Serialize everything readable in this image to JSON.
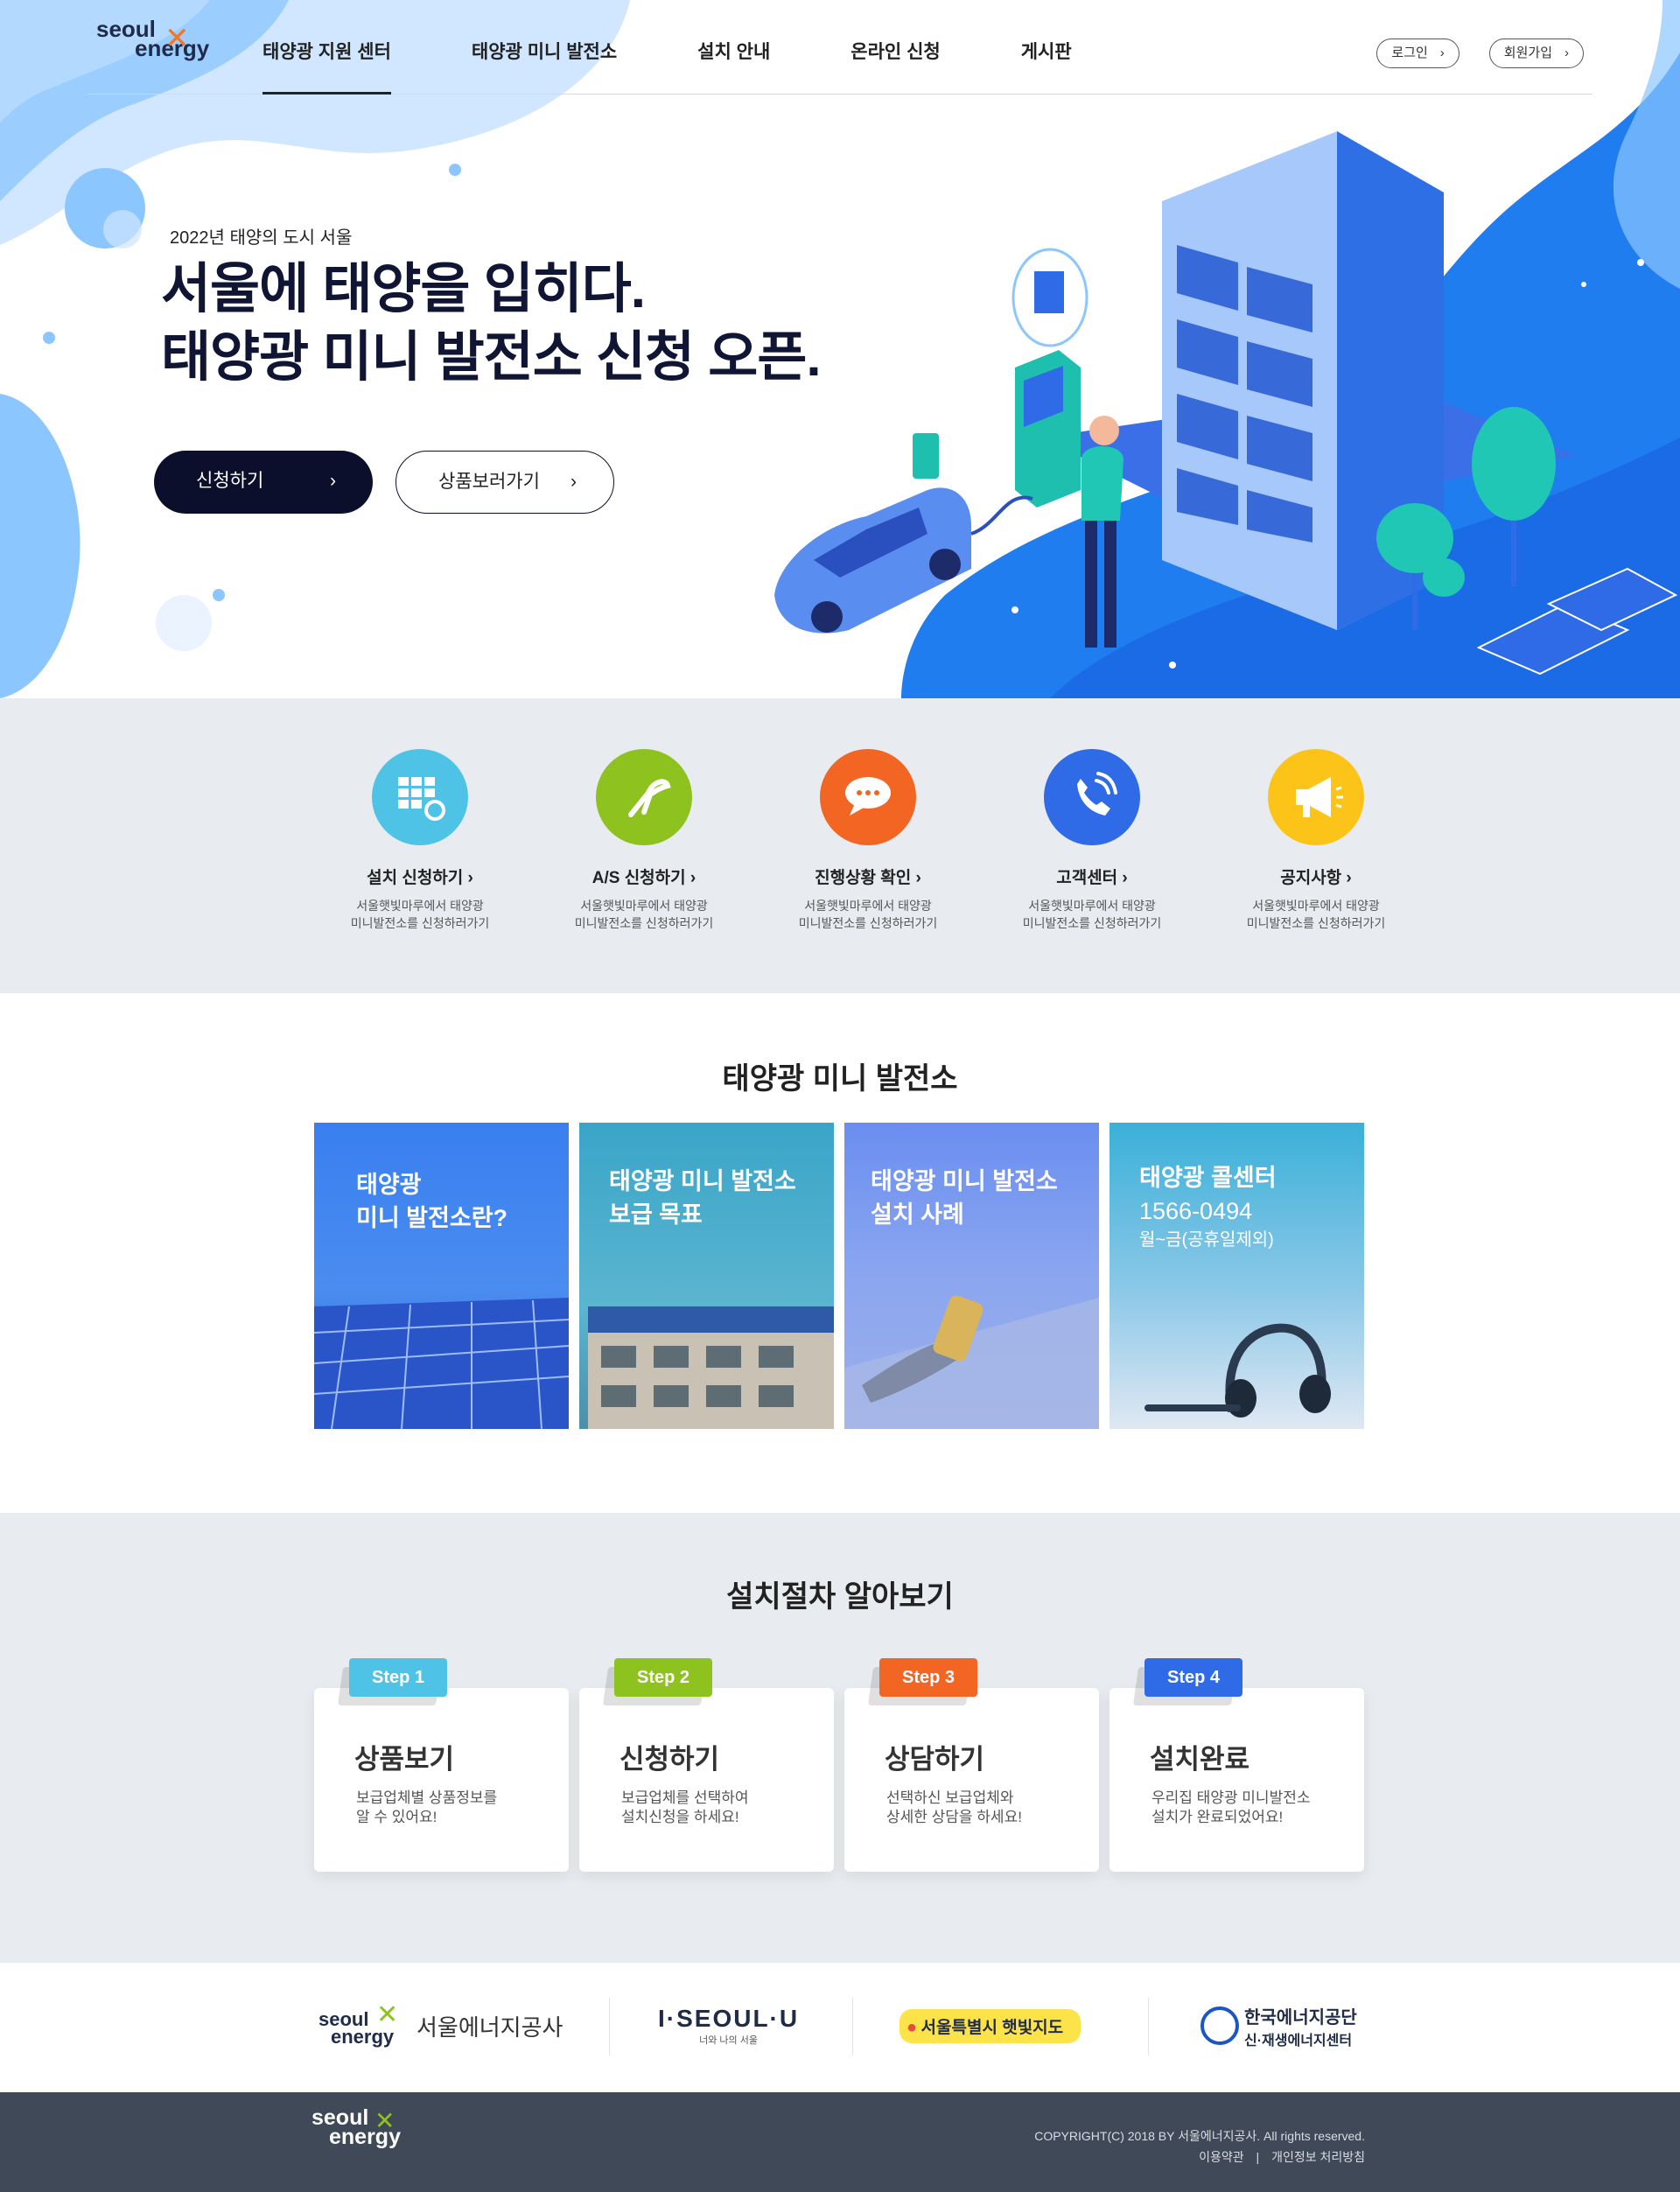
{
  "brand": {
    "logo_line1": "seoul",
    "logo_line2": "energy",
    "logo_mark": "✕"
  },
  "nav": {
    "items": [
      {
        "label": "태양광 지원 센터"
      },
      {
        "label": "태양광 미니 발전소"
      },
      {
        "label": "설치 안내"
      },
      {
        "label": "온라인 신청"
      },
      {
        "label": "게시판"
      }
    ],
    "login": "로그인",
    "signup": "회원가입",
    "chevron": "›"
  },
  "hero": {
    "subtitle": "2022년 태양의 도시 서울",
    "headline_line1": "서울에 태양을 입히다.",
    "headline_line2": "태양광 미니 발전소 신청 오픈.",
    "primary_button": "신청하기",
    "secondary_button": "상품보러가기",
    "chevron": "›"
  },
  "quick_links": [
    {
      "title": "설치 신청하기 ›",
      "desc1": "서울햇빛마루에서 태양광",
      "desc2": "미니발전소를 신청하러가기",
      "color": "#4fc3e6",
      "icon": "solar-panel-gear-icon"
    },
    {
      "title": "A/S 신청하기 ›",
      "desc1": "서울햇빛마루에서 태양광",
      "desc2": "미니발전소를 신청하러가기",
      "color": "#8dc21f",
      "icon": "pliers-icon"
    },
    {
      "title": "진행상황 확인 ›",
      "desc1": "서울햇빛마루에서 태양광",
      "desc2": "미니발전소를 신청하러가기",
      "color": "#f26522",
      "icon": "chat-bubble-icon"
    },
    {
      "title": "고객센터 ›",
      "desc1": "서울햇빛마루에서 태양광",
      "desc2": "미니발전소를 신청하러가기",
      "color": "#2f6be6",
      "icon": "phone-icon"
    },
    {
      "title": "공지사항 ›",
      "desc1": "서울햇빛마루에서 태양광",
      "desc2": "미니발전소를 신청하러가기",
      "color": "#fcc419",
      "icon": "megaphone-icon"
    }
  ],
  "mini": {
    "title": "태양광 미니 발전소",
    "cards": [
      {
        "line1": "태양광",
        "line2": "미니 발전소란?"
      },
      {
        "line1": "태양광 미니 발전소",
        "line2": "보급 목표"
      },
      {
        "line1": "태양광 미니 발전소",
        "line2": "설치 사례"
      },
      {
        "line1": "태양광 콜센터",
        "line2": "1566-0494",
        "line3": "월~금(공휴일제외)"
      }
    ]
  },
  "process": {
    "title": "설치절차 알아보기",
    "steps": [
      {
        "tag": "Step 1",
        "title": "상품보기",
        "desc1": "보급업체별 상품정보를",
        "desc2": "알 수 있어요!",
        "color": "#4fc3e6"
      },
      {
        "tag": "Step 2",
        "title": "신청하기",
        "desc1": "보급업체를 선택하여",
        "desc2": "설치신청을 하세요!",
        "color": "#8dc21f"
      },
      {
        "tag": "Step 3",
        "title": "상담하기",
        "desc1": "선택하신 보급업체와",
        "desc2": "상세한 상담을 하세요!",
        "color": "#f26522"
      },
      {
        "tag": "Step 4",
        "title": "설치완료",
        "desc1": "우리집 태양광 미니발전소",
        "desc2": "설치가 완료되었어요!",
        "color": "#2f6be6"
      }
    ]
  },
  "partners": {
    "p1_a": "seoul",
    "p1_b": "energy",
    "p1_name": "서울에너지공사",
    "p2_name": "I·SEOUL·U",
    "p2_sub": "너와 나의 서울",
    "p3_name": "서울특별시 햇빛지도",
    "p4_name": "한국에너지공단",
    "p4_sub": "신·재생에너지센터"
  },
  "footer": {
    "logo_line1": "seoul",
    "logo_line2": "energy",
    "copyright": "COPYRIGHT(C) 2018 BY 서울에너지공사. All rights reserved.",
    "terms": "이용약관",
    "separator": "|",
    "privacy": "개인정보 처리방침"
  }
}
